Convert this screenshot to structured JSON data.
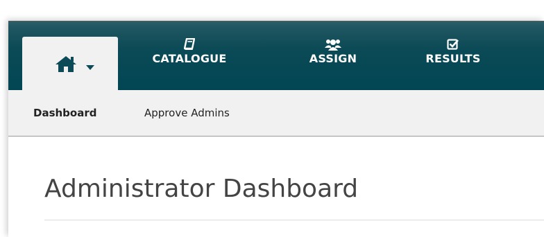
{
  "colors": {
    "topbar": "#024654",
    "home_tab_bg": "#f1f1f1",
    "home_icon": "#0b4a56",
    "subbar_bg": "#f1f1f1",
    "title_text": "#444444"
  },
  "topnav": {
    "home": {
      "icon": "home-icon",
      "dropdown_icon": "caret-down-icon"
    },
    "items": [
      {
        "label": "CATALOGUE",
        "icon": "book-icon"
      },
      {
        "label": "ASSIGN",
        "icon": "users-icon"
      },
      {
        "label": "RESULTS",
        "icon": "checkbox-icon"
      }
    ]
  },
  "subnav": {
    "items": [
      {
        "label": "Dashboard",
        "active": true
      },
      {
        "label": "Approve Admins",
        "active": false
      }
    ]
  },
  "main": {
    "title": "Administrator Dashboard"
  }
}
